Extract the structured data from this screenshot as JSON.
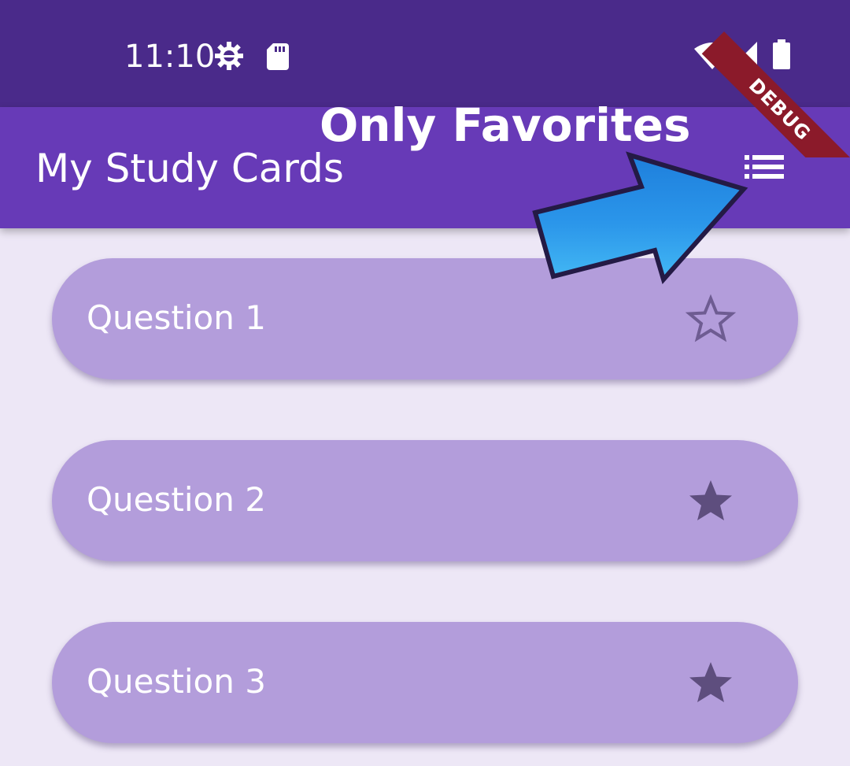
{
  "status_bar": {
    "time": "11:10",
    "icons": [
      "settings-gear-icon",
      "sd-card-icon",
      "wifi-icon",
      "signal-icon",
      "battery-icon"
    ]
  },
  "app_bar": {
    "title": "My Study Cards",
    "filter_icon": "list-icon"
  },
  "annotation": {
    "text": "Only Favorites",
    "arrow_color": "#1E88E5"
  },
  "cards": [
    {
      "label": "Question 1",
      "favorite": false,
      "star_icon": "star-outline-icon"
    },
    {
      "label": "Question 2",
      "favorite": true,
      "star_icon": "star-filled-icon"
    },
    {
      "label": "Question 3",
      "favorite": true,
      "star_icon": "star-filled-icon"
    }
  ],
  "debug_banner": "DEBUG",
  "colors": {
    "status_bar": "#4A2A8A",
    "app_bar": "#673AB7",
    "background": "#EDE7F6",
    "card": "#B39DDB",
    "star": "#5E4E7E",
    "debug": "#8B1A2A"
  }
}
